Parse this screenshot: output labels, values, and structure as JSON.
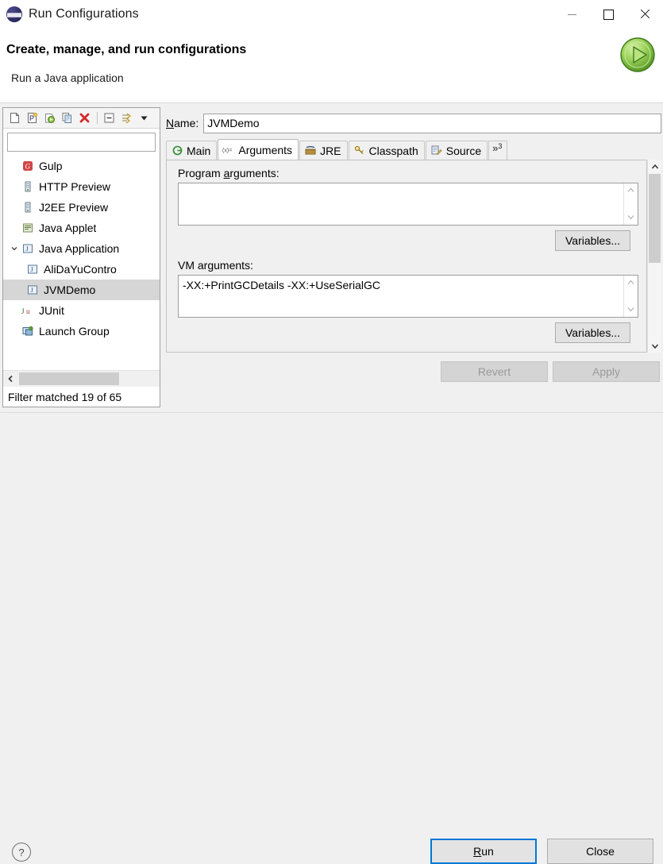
{
  "window": {
    "title": "Run Configurations",
    "icon": "eclipse-launch-icon",
    "controls": {
      "minimize": "minimize-icon",
      "maximize": "maximize-icon",
      "close": "close-icon"
    }
  },
  "header": {
    "title": "Create, manage, and run configurations",
    "subtitle": "Run a Java application",
    "run_icon": "green-run-play-icon"
  },
  "left_panel": {
    "toolbar": [
      {
        "name": "new-launch-configuration-icon",
        "glyph": "⬜"
      },
      {
        "name": "new-prototype-icon",
        "glyph": "P"
      },
      {
        "name": "export-launch-configuration-icon",
        "glyph": "●"
      },
      {
        "name": "duplicate-icon",
        "glyph": "⧉"
      },
      {
        "name": "delete-icon",
        "glyph": "✕"
      },
      {
        "name": "collapse-all-icon",
        "glyph": "⊟"
      },
      {
        "name": "filter-launch-configurations-icon",
        "glyph": "⇥"
      },
      {
        "name": "view-menu-chevron-icon",
        "glyph": "▼"
      }
    ],
    "filter": {
      "value": "",
      "placeholder": ""
    },
    "tree": [
      {
        "label": "Gulp",
        "icon": "gulp-icon",
        "icon_glyph": "G",
        "indent": 0,
        "expander": "",
        "selected": false
      },
      {
        "label": "HTTP Preview",
        "icon": "server-icon",
        "icon_glyph": "█",
        "indent": 0,
        "expander": "",
        "selected": false
      },
      {
        "label": "J2EE Preview",
        "icon": "server-icon",
        "icon_glyph": "█",
        "indent": 0,
        "expander": "",
        "selected": false
      },
      {
        "label": "Java Applet",
        "icon": "java-applet-icon",
        "icon_glyph": "⌗",
        "indent": 0,
        "expander": "",
        "selected": false
      },
      {
        "label": "Java Application",
        "icon": "java-application-icon",
        "icon_glyph": "J",
        "indent": 0,
        "expander": "⌄",
        "selected": false
      },
      {
        "label": "AliDaYuContro",
        "icon": "java-application-icon",
        "icon_glyph": "J",
        "indent": 1,
        "expander": "",
        "selected": false
      },
      {
        "label": "JVMDemo",
        "icon": "java-application-icon",
        "icon_glyph": "J",
        "indent": 1,
        "expander": "",
        "selected": true
      },
      {
        "label": "JUnit",
        "icon": "junit-icon",
        "icon_glyph": "Ju",
        "indent": 0,
        "expander": "",
        "selected": false
      },
      {
        "label": "Launch Group",
        "icon": "launch-group-icon",
        "icon_glyph": "▣",
        "indent": 0,
        "expander": "",
        "selected": false
      }
    ],
    "hscroll": {
      "left_arrow": "chevron-left-icon"
    },
    "status": "Filter matched 19 of 65"
  },
  "right_panel": {
    "name_label": "Name:",
    "name_mnemonic": "N",
    "name_value": "JVMDemo",
    "tabs": [
      {
        "label": "Main",
        "icon": "main-tab-icon",
        "icon_glyph": "◉",
        "active": false
      },
      {
        "label": "Arguments",
        "icon": "arguments-tab-icon",
        "icon_glyph": "(x)=",
        "active": true
      },
      {
        "label": "JRE",
        "icon": "jre-tab-icon",
        "icon_glyph": "▤",
        "active": false
      },
      {
        "label": "Classpath",
        "icon": "classpath-tab-icon",
        "icon_glyph": "⚙",
        "active": false
      },
      {
        "label": "Source",
        "icon": "source-tab-icon",
        "icon_glyph": "✎",
        "active": false
      }
    ],
    "tab_overflow": {
      "chevrons": "»",
      "count": "3"
    },
    "program_arguments": {
      "label": "Program arguments:",
      "mnemonic": "a",
      "value": "",
      "placeholder": ""
    },
    "vm_arguments": {
      "label": "VM arguments:",
      "value": "-XX:+PrintGCDetails -XX:+UseSerialGC",
      "placeholder": ""
    },
    "variables_button_1": "Variables...",
    "variables_button_2": "Variables...",
    "scroll_up_icon": "chevron-up-icon",
    "scroll_down_icon": "chevron-down-icon",
    "revert_button": {
      "label": "Revert",
      "enabled": false
    },
    "apply_button": {
      "label": "Apply",
      "enabled": false
    }
  },
  "footer": {
    "help_icon": "help-question-icon",
    "help_glyph": "?",
    "run_button": {
      "label": "Run",
      "default": true
    },
    "close_button": {
      "label": "Close",
      "default": false
    }
  },
  "colors": {
    "accent": "#0078d7",
    "window_bg": "#f0f0f0",
    "panel_bg": "#ffffff",
    "selection": "#d6d6d6",
    "delete_red": "#d42b2b",
    "run_green": "#7bc043"
  }
}
